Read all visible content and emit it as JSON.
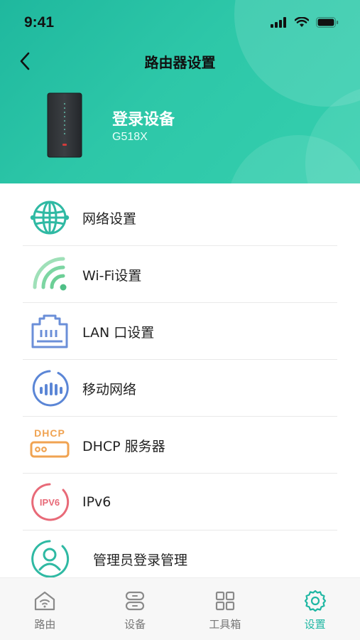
{
  "status_bar": {
    "time": "9:41"
  },
  "nav": {
    "title": "路由器设置"
  },
  "device": {
    "name": "登录设备",
    "model": "G518X"
  },
  "menu": [
    {
      "label": "网络设置",
      "icon": "globe-icon"
    },
    {
      "label": "Wi-Fi设置",
      "icon": "wifi-icon"
    },
    {
      "label": "LAN 口设置",
      "icon": "lan-port-icon"
    },
    {
      "label": "移动网络",
      "icon": "mobile-network-icon"
    },
    {
      "label": "DHCP 服务器",
      "icon": "dhcp-icon",
      "icon_text": "DHCP"
    },
    {
      "label": "IPv6",
      "icon": "ipv6-icon",
      "icon_text": "IPV6"
    },
    {
      "label": "管理员登录管理",
      "icon": "admin-icon"
    }
  ],
  "tabs": [
    {
      "label": "路由",
      "icon": "home-wifi-icon",
      "active": false
    },
    {
      "label": "设备",
      "icon": "devices-icon",
      "active": false
    },
    {
      "label": "工具箱",
      "icon": "toolbox-icon",
      "active": false
    },
    {
      "label": "设置",
      "icon": "settings-icon",
      "active": true
    }
  ],
  "colors": {
    "header_start": "#1fb89e",
    "header_end": "#35cfae",
    "accent": "#1fb7a3",
    "globe": "#2fb9a3",
    "wifi": "#5cc48a",
    "lan": "#6b8fd8",
    "mobile": "#5b86d6",
    "dhcp": "#f0a352",
    "ipv6": "#e86a78",
    "admin": "#2fb9a3"
  }
}
